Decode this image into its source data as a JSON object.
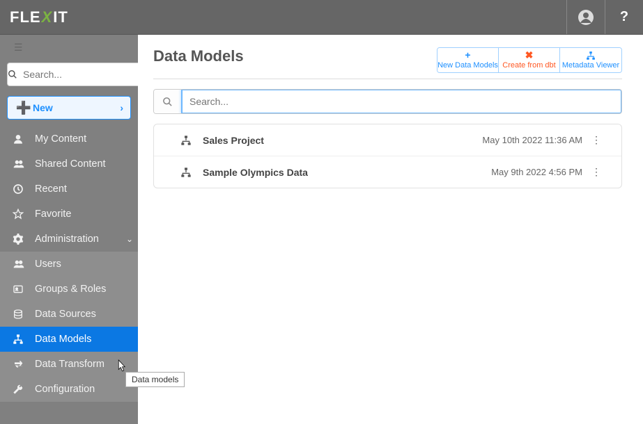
{
  "header": {
    "logo_pre": "FLE",
    "logo_mid": "X",
    "logo_post": "IT"
  },
  "sidebar": {
    "search_placeholder": "Search...",
    "new_label": "New",
    "items": [
      {
        "label": "My Content"
      },
      {
        "label": "Shared Content"
      },
      {
        "label": "Recent"
      },
      {
        "label": "Favorite"
      },
      {
        "label": "Administration"
      }
    ],
    "admin_items": [
      {
        "label": "Users"
      },
      {
        "label": "Groups & Roles"
      },
      {
        "label": "Data Sources"
      },
      {
        "label": "Data Models"
      },
      {
        "label": "Data Transform"
      },
      {
        "label": "Configuration"
      }
    ],
    "tooltip": "Data models"
  },
  "page": {
    "title": "Data Models",
    "actions": {
      "new": "New Data Models",
      "dbt": "Create from dbt",
      "meta": "Metadata Viewer"
    },
    "search_placeholder": "Search...",
    "rows": [
      {
        "name": "Sales Project",
        "ts": "May 10th 2022 11:36 AM"
      },
      {
        "name": "Sample Olympics Data",
        "ts": "May 9th 2022 4:56 PM"
      }
    ]
  }
}
